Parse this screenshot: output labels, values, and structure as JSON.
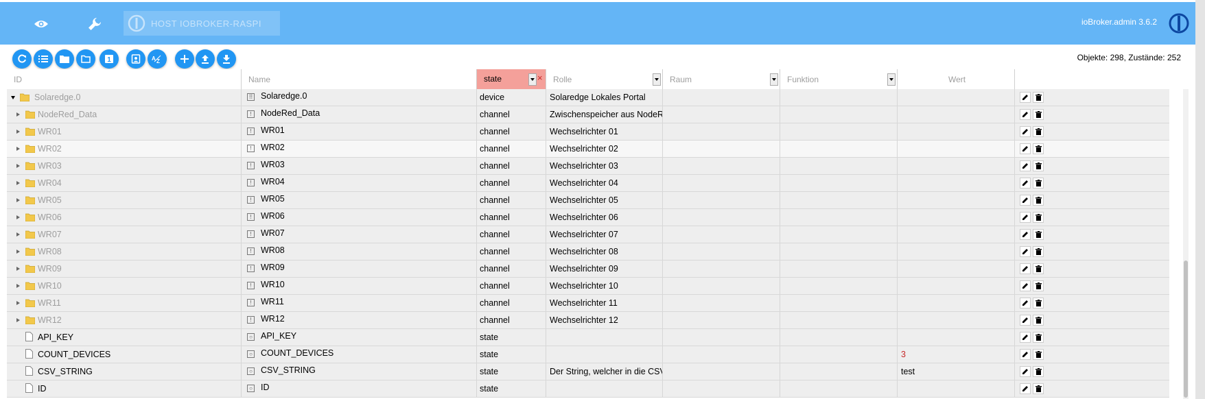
{
  "header": {
    "host_label": "HOST IOBROKER-RASPI",
    "version": "ioBroker.admin 3.6.2"
  },
  "icons": {
    "eye": "eye-icon",
    "wrench": "wrench-icon",
    "logo": "iobroker-logo-icon"
  },
  "toolbar": {
    "buttons": [
      "refresh-icon",
      "list-icon",
      "folder-icon",
      "folder-outline-icon",
      "number-one-icon",
      "contact-icon",
      "sort-az-icon",
      "add-icon",
      "upload-icon",
      "download-icon"
    ],
    "stats": "Objekte: 298, Zustände: 252"
  },
  "columns": {
    "id_placeholder": "ID",
    "name_placeholder": "Name",
    "type_filter": "state",
    "role_placeholder": "Rolle",
    "room_placeholder": "Raum",
    "function_placeholder": "Funktion",
    "value_header": "Wert"
  },
  "colors": {
    "topbar": "#64b5f6",
    "button": "#2196f3",
    "filter_active": "#f4a09a",
    "value_number": "#c62828"
  },
  "rows": [
    {
      "id": "Solaredge.0",
      "name": "Solaredge.0",
      "type": "device",
      "role": "Solaredge Lokales Portal",
      "value": ""
    },
    {
      "id": "NodeRed_Data",
      "name": "NodeRed_Data",
      "type": "channel",
      "role": "Zwischenspeicher aus NodeRed",
      "value": ""
    },
    {
      "id": "WR01",
      "name": "WR01",
      "type": "channel",
      "role": "Wechselrichter 01",
      "value": ""
    },
    {
      "id": "WR02",
      "name": "WR02",
      "type": "channel",
      "role": "Wechselrichter 02",
      "value": ""
    },
    {
      "id": "WR03",
      "name": "WR03",
      "type": "channel",
      "role": "Wechselrichter 03",
      "value": ""
    },
    {
      "id": "WR04",
      "name": "WR04",
      "type": "channel",
      "role": "Wechselrichter 04",
      "value": ""
    },
    {
      "id": "WR05",
      "name": "WR05",
      "type": "channel",
      "role": "Wechselrichter 05",
      "value": ""
    },
    {
      "id": "WR06",
      "name": "WR06",
      "type": "channel",
      "role": "Wechselrichter 06",
      "value": ""
    },
    {
      "id": "WR07",
      "name": "WR07",
      "type": "channel",
      "role": "Wechselrichter 07",
      "value": ""
    },
    {
      "id": "WR08",
      "name": "WR08",
      "type": "channel",
      "role": "Wechselrichter 08",
      "value": ""
    },
    {
      "id": "WR09",
      "name": "WR09",
      "type": "channel",
      "role": "Wechselrichter 09",
      "value": ""
    },
    {
      "id": "WR10",
      "name": "WR10",
      "type": "channel",
      "role": "Wechselrichter 10",
      "value": ""
    },
    {
      "id": "WR11",
      "name": "WR11",
      "type": "channel",
      "role": "Wechselrichter 11",
      "value": ""
    },
    {
      "id": "WR12",
      "name": "WR12",
      "type": "channel",
      "role": "Wechselrichter 12",
      "value": ""
    },
    {
      "id": "API_KEY",
      "name": "API_KEY",
      "type": "state",
      "role": "",
      "value": ""
    },
    {
      "id": "COUNT_DEVICES",
      "name": "COUNT_DEVICES",
      "type": "state",
      "role": "",
      "value": "3"
    },
    {
      "id": "CSV_STRING",
      "name": "CSV_STRING",
      "type": "state",
      "role": "Der String, welcher in die CSV",
      "value": "test"
    },
    {
      "id": "ID",
      "name": "ID",
      "type": "state",
      "role": "",
      "value": ""
    }
  ]
}
